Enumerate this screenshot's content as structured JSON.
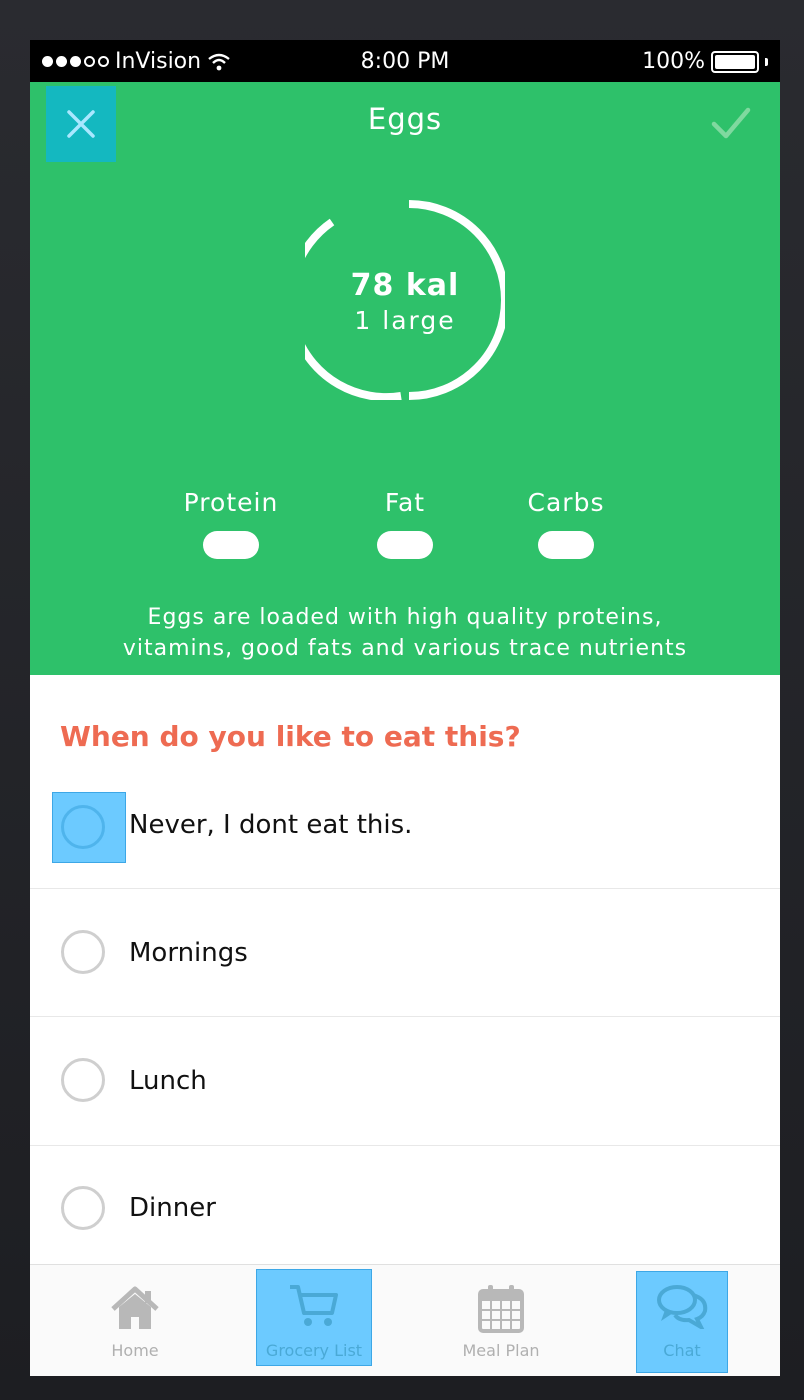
{
  "status_bar": {
    "carrier": "InVision",
    "time": "8:00 PM",
    "battery": "100%"
  },
  "header": {
    "title": "Eggs"
  },
  "summary": {
    "calories": "78 kal",
    "portion": "1 large"
  },
  "macros": [
    {
      "label": "Protein"
    },
    {
      "label": "Fat"
    },
    {
      "label": "Carbs"
    }
  ],
  "description": {
    "line1": "Eggs are loaded with high quality proteins,",
    "line2": "vitamins, good fats and various trace nutrients"
  },
  "question": "When do you like to eat this?",
  "options": [
    {
      "label": "Never, I dont eat this."
    },
    {
      "label": "Mornings"
    },
    {
      "label": "Lunch"
    },
    {
      "label": "Dinner"
    }
  ],
  "tabs": [
    {
      "label": "Home",
      "icon": "home-icon"
    },
    {
      "label": "Grocery List",
      "icon": "cart-icon"
    },
    {
      "label": "Meal Plan",
      "icon": "calendar-icon"
    },
    {
      "label": "Chat",
      "icon": "chat-icon"
    }
  ],
  "colors": {
    "hero_green": "#2ec16a",
    "close_teal": "#14b8c0",
    "question_orange": "#ee6b52",
    "highlight_blue": "#6ccaff"
  }
}
